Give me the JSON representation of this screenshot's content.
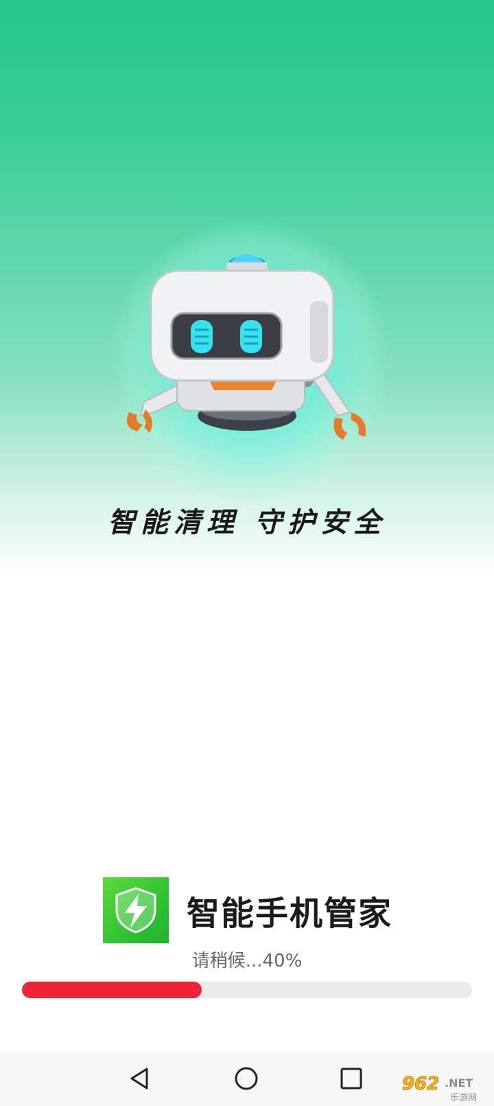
{
  "splash": {
    "slogan": "智能清理 守护安全"
  },
  "brand": {
    "app_name": "智能手机管家",
    "icon": "lightning-shield-icon"
  },
  "loading": {
    "text": "请稍候...40%",
    "progress": 0.4
  },
  "colors": {
    "top_green": "#22c78a",
    "glow_cyan": "#50f0eb",
    "progress_fill": "#ee2436",
    "progress_track": "#ebebeb",
    "app_icon_green": "#2fc233"
  },
  "navbar": {
    "back": "back-triangle-icon",
    "home": "home-circle-icon",
    "recents": "recents-square-icon"
  },
  "watermark": {
    "text_main": "962",
    "text_net": ".NET",
    "text_sub": "乐游网"
  }
}
